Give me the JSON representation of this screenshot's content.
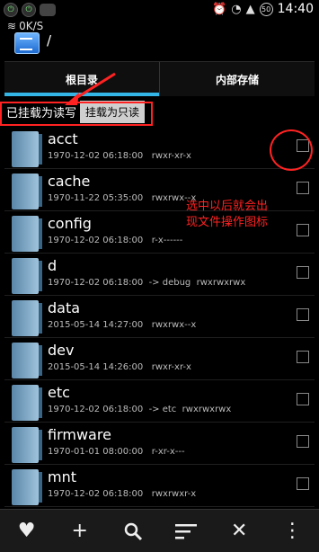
{
  "status_bar": {
    "clock": "14:40",
    "battery": "50",
    "icons": [
      "power-icon",
      "power-icon",
      "cat-icon",
      "alarm-icon",
      "wifi-icon",
      "signal-icon",
      "battery-icon"
    ]
  },
  "app_bar": {
    "speed": "0K/S",
    "path": "/"
  },
  "tabs": [
    {
      "label": "根目录",
      "active": true
    },
    {
      "label": "内部存储",
      "active": false
    }
  ],
  "mount": {
    "status": "已挂载为读写",
    "button_label": "挂载为只读"
  },
  "files": [
    {
      "name": "acct",
      "meta": "1970-12-02 06:18:00   rwxr-xr-x"
    },
    {
      "name": "cache",
      "meta": "1970-11-22 05:35:00   rwxrwx--x"
    },
    {
      "name": "config",
      "meta": "1970-12-02 06:18:00   r-x------"
    },
    {
      "name": "d",
      "meta": "1970-12-02 06:18:00  -> debug  rwxrwxrwx"
    },
    {
      "name": "data",
      "meta": "2015-05-14 14:27:00   rwxrwx--x"
    },
    {
      "name": "dev",
      "meta": "2015-05-14 14:26:00   rwxr-xr-x"
    },
    {
      "name": "etc",
      "meta": "1970-12-02 06:18:00  -> etc  rwxrwxrwx"
    },
    {
      "name": "firmware",
      "meta": "1970-01-01 08:00:00   r-xr-x---"
    },
    {
      "name": "mnt",
      "meta": "1970-12-02 06:18:00   rwxrwxr-x"
    }
  ],
  "annotation": {
    "text": "选中以后就会出现文件操作图标",
    "color": "#ff2222"
  },
  "bottom_bar": {
    "icons": [
      "heart-icon",
      "add-icon",
      "search-icon",
      "sort-icon",
      "close-icon",
      "more-icon"
    ]
  }
}
